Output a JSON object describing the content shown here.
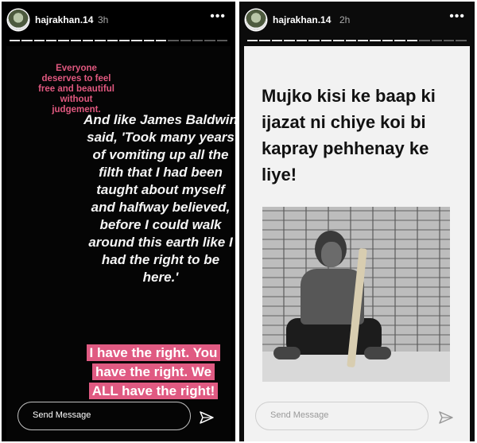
{
  "stories": [
    {
      "username": "hajrakhan.14",
      "time": "3h",
      "more": "•••",
      "pink_note": "Everyone deserves to feel free and beautiful without judgement.",
      "quote": "And like James Baldwin said, 'Took many years of vomiting up all the filth that I had been taught about myself and halfway believed, before I could walk around this earth like I had the right to be here.'",
      "highlight": "I have the right. You have the right. We ALL have the right!",
      "send_placeholder": "Send Message",
      "progress": {
        "segments": 18,
        "filled": 13
      }
    },
    {
      "username": "hajrakhan.14",
      "time": "2h",
      "more": "•••",
      "title": "Mujko kisi ke baap ki ijazat ni chiye koi bi kapray pehhenay ke liye!",
      "send_placeholder": "Send Message",
      "progress": {
        "segments": 18,
        "filled": 14
      }
    }
  ],
  "colors": {
    "accent_pink": "#e05a82",
    "note_pink": "#e0587f"
  },
  "icons": [
    "more-icon",
    "send-icon",
    "avatar"
  ]
}
